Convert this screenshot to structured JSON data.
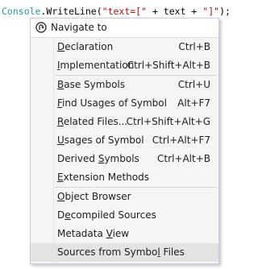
{
  "code": {
    "tok1": "Console",
    "tok2": ".WriteLine(",
    "tok3": "\"text=[\"",
    "tok4": " + text + ",
    "tok5": "\"]\"",
    "tok6": ");"
  },
  "popup": {
    "title": "Navigate to",
    "icon": "navigate-icon",
    "items": [
      {
        "pre": "",
        "mn": "D",
        "post": "eclaration",
        "shortcut": "Ctrl+B"
      },
      {
        "pre": "",
        "mn": "I",
        "post": "mplementation",
        "shortcut": "Ctrl+Shift+Alt+B"
      },
      {
        "pre": "",
        "mn": "B",
        "post": "ase Symbols",
        "shortcut": "Ctrl+U"
      },
      {
        "pre": "",
        "mn": "F",
        "post": "ind Usages of Symbol",
        "shortcut": "Alt+F7"
      },
      {
        "pre": "",
        "mn": "R",
        "post": "elated Files...",
        "shortcut": "Ctrl+Shift+Alt+G"
      },
      {
        "pre": "",
        "mn": "U",
        "post": "sages of Symbol",
        "shortcut": "Ctrl+Alt+F7"
      },
      {
        "pre": "Derived ",
        "mn": "S",
        "post": "ymbols",
        "shortcut": "Ctrl+Alt+B"
      },
      {
        "pre": "",
        "mn": "E",
        "post": "xtension Methods",
        "shortcut": ""
      },
      {
        "pre": "",
        "mn": "O",
        "post": "bject Browser",
        "shortcut": ""
      },
      {
        "pre": "D",
        "mn": "e",
        "post": "compiled Sources",
        "shortcut": ""
      },
      {
        "pre": "Metadata ",
        "mn": "V",
        "post": "iew",
        "shortcut": ""
      },
      {
        "pre": "Sources from Symbo",
        "mn": "l",
        "post": " Files",
        "shortcut": ""
      }
    ]
  }
}
